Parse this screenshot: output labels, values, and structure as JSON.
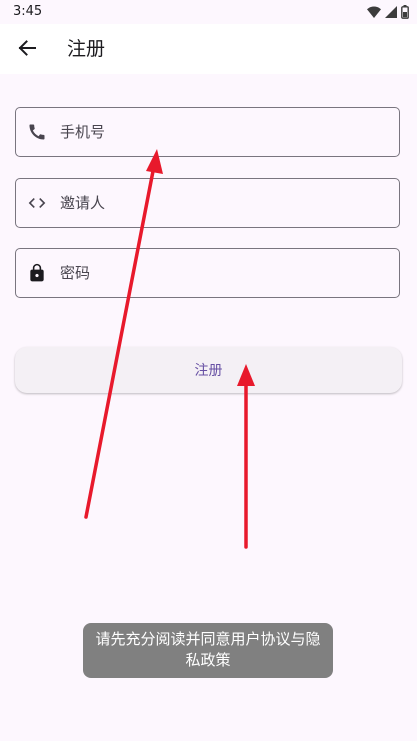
{
  "status_bar": {
    "time": "3:45",
    "icons": [
      "wifi-icon",
      "signal-icon",
      "battery-icon"
    ]
  },
  "app_bar": {
    "back_icon": "arrow-left-icon",
    "title": "注册"
  },
  "form": {
    "phone": {
      "icon": "phone-icon",
      "placeholder": "手机号",
      "value": ""
    },
    "inviter": {
      "icon": "code-icon",
      "placeholder": "邀请人",
      "value": ""
    },
    "password": {
      "icon": "lock-icon",
      "placeholder": "密码",
      "value": ""
    },
    "submit_label": "注册"
  },
  "toast": {
    "message": "请先充分阅读并同意用户协议与隐私政策"
  },
  "colors": {
    "background": "#fdf7fe",
    "outline": "#79757f",
    "primary": "#6750a4",
    "annotation_arrow": "#e8192c",
    "toast_bg": "#808080"
  }
}
